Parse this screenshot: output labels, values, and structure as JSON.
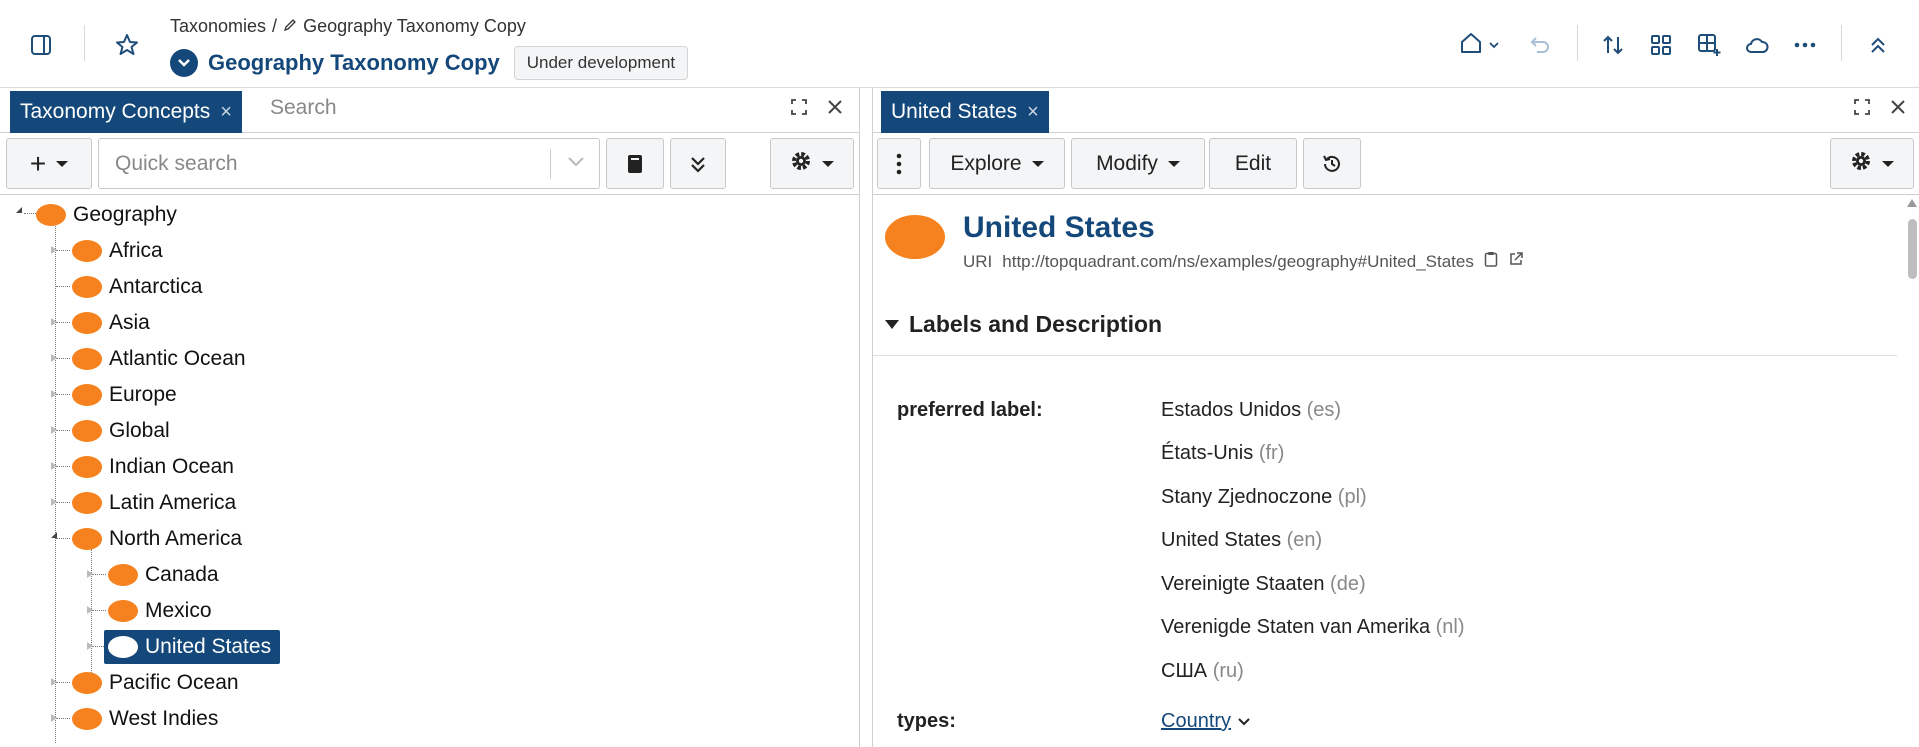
{
  "header": {
    "breadcrumb_root": "Taxonomies",
    "breadcrumb_separator": "/",
    "breadcrumb_current": "Geography Taxonomy Copy",
    "title": "Geography Taxonomy Copy",
    "status": "Under development",
    "icons": [
      "sidebar-toggle-icon",
      "star-icon",
      "pencil-icon",
      "chevron-down-icon",
      "home-icon",
      "undo-icon",
      "sort-icon",
      "grid-icon",
      "add-grid-icon",
      "cloud-icon",
      "more-icon",
      "collapse-up-icon"
    ]
  },
  "left_panel": {
    "tab_label": "Taxonomy Concepts",
    "tab_close": "×",
    "search_tab_label": "Search",
    "quick_search_placeholder": "Quick search",
    "add_label": "+",
    "tree": {
      "root": "Geography",
      "children": [
        "Africa",
        "Antarctica",
        "Asia",
        "Atlantic Ocean",
        "Europe",
        "Global",
        "Indian Ocean",
        "Latin America",
        "North America",
        "Pacific Ocean",
        "West Indies"
      ],
      "north_america_children": [
        "Canada",
        "Mexico",
        "United States"
      ],
      "selected": "United States"
    }
  },
  "right_panel": {
    "tab_label": "United States",
    "tab_close": "×",
    "toolbar": {
      "explore": "Explore",
      "modify": "Modify",
      "edit": "Edit"
    },
    "resource_title": "United States",
    "uri_label": "URI",
    "uri": "http://topquadrant.com/ns/examples/geography#United_States",
    "section_title": "Labels and Description",
    "preferred_label_heading": "preferred label:",
    "preferred_labels": [
      {
        "text": "Estados Unidos",
        "lang": "(es)"
      },
      {
        "text": "États-Unis",
        "lang": "(fr)"
      },
      {
        "text": "Stany Zjednoczone",
        "lang": "(pl)"
      },
      {
        "text": "United States",
        "lang": "(en)"
      },
      {
        "text": "Vereinigte Staaten",
        "lang": "(de)"
      },
      {
        "text": "Verenigde Staten van Amerika",
        "lang": "(nl)"
      },
      {
        "text": "США",
        "lang": "(ru)"
      }
    ],
    "types_heading": "types:",
    "type_value": "Country"
  },
  "colors": {
    "brand_blue": "#15487a",
    "concept_orange": "#f5821f"
  }
}
